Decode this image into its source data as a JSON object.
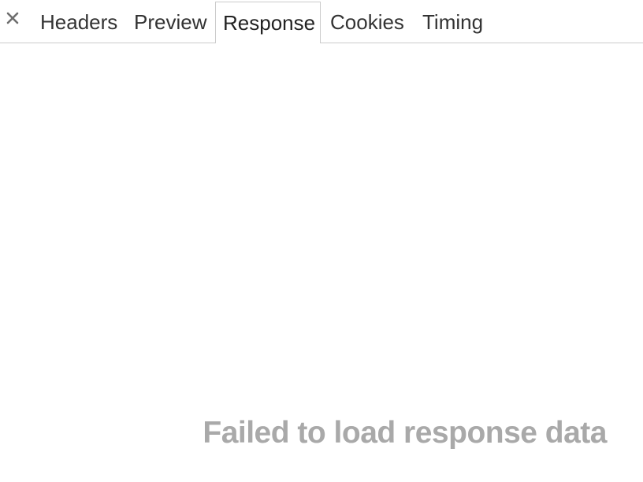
{
  "tabbar": {
    "close_icon": "close-icon",
    "tabs": [
      {
        "label": "Headers"
      },
      {
        "label": "Preview"
      },
      {
        "label": "Response",
        "active": true
      },
      {
        "label": "Cookies"
      },
      {
        "label": "Timing"
      }
    ]
  },
  "content": {
    "message": "Failed to load response data"
  },
  "colors": {
    "tab_text": "#333333",
    "border": "#cbcbcb",
    "message_text": "#a9a9a9",
    "background": "#ffffff"
  }
}
